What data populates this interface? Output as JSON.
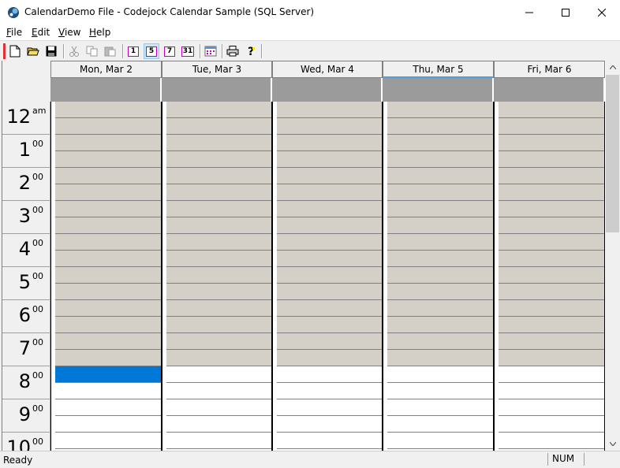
{
  "window": {
    "title": "CalendarDemo File - Codejock Calendar Sample (SQL Server)"
  },
  "menu": [
    {
      "label": "File",
      "key": "F"
    },
    {
      "label": "Edit",
      "key": "E"
    },
    {
      "label": "View",
      "key": "V"
    },
    {
      "label": "Help",
      "key": "H"
    }
  ],
  "toolbar": {
    "day_view": "1",
    "work_week_view": "5",
    "week_view": "7",
    "month_view": "31",
    "active_view": "work_week"
  },
  "calendar": {
    "days": [
      {
        "label": "Mon, Mar 2",
        "today": false
      },
      {
        "label": "Tue, Mar 3",
        "today": false
      },
      {
        "label": "Wed, Mar 4",
        "today": false
      },
      {
        "label": "Thu, Mar 5",
        "today": true
      },
      {
        "label": "Fri, Mar 6",
        "today": false
      }
    ],
    "hours": [
      {
        "num": "12",
        "sup": "am"
      },
      {
        "num": "1",
        "sup": "00"
      },
      {
        "num": "2",
        "sup": "00"
      },
      {
        "num": "3",
        "sup": "00"
      },
      {
        "num": "4",
        "sup": "00"
      },
      {
        "num": "5",
        "sup": "00"
      },
      {
        "num": "6",
        "sup": "00"
      },
      {
        "num": "7",
        "sup": "00"
      },
      {
        "num": "8",
        "sup": "00"
      },
      {
        "num": "9",
        "sup": "00"
      },
      {
        "num": "10",
        "sup": "00"
      }
    ],
    "work_day_start_hour": 8,
    "selected_slot": {
      "day": 0,
      "hour": 8,
      "half": 0
    },
    "colors": {
      "non_work": "#d4d0c8",
      "work": "#ffffff",
      "selection": "#0078d7",
      "all_day": "#9b9b9b"
    }
  },
  "status": {
    "text": "Ready",
    "num": "NUM"
  }
}
